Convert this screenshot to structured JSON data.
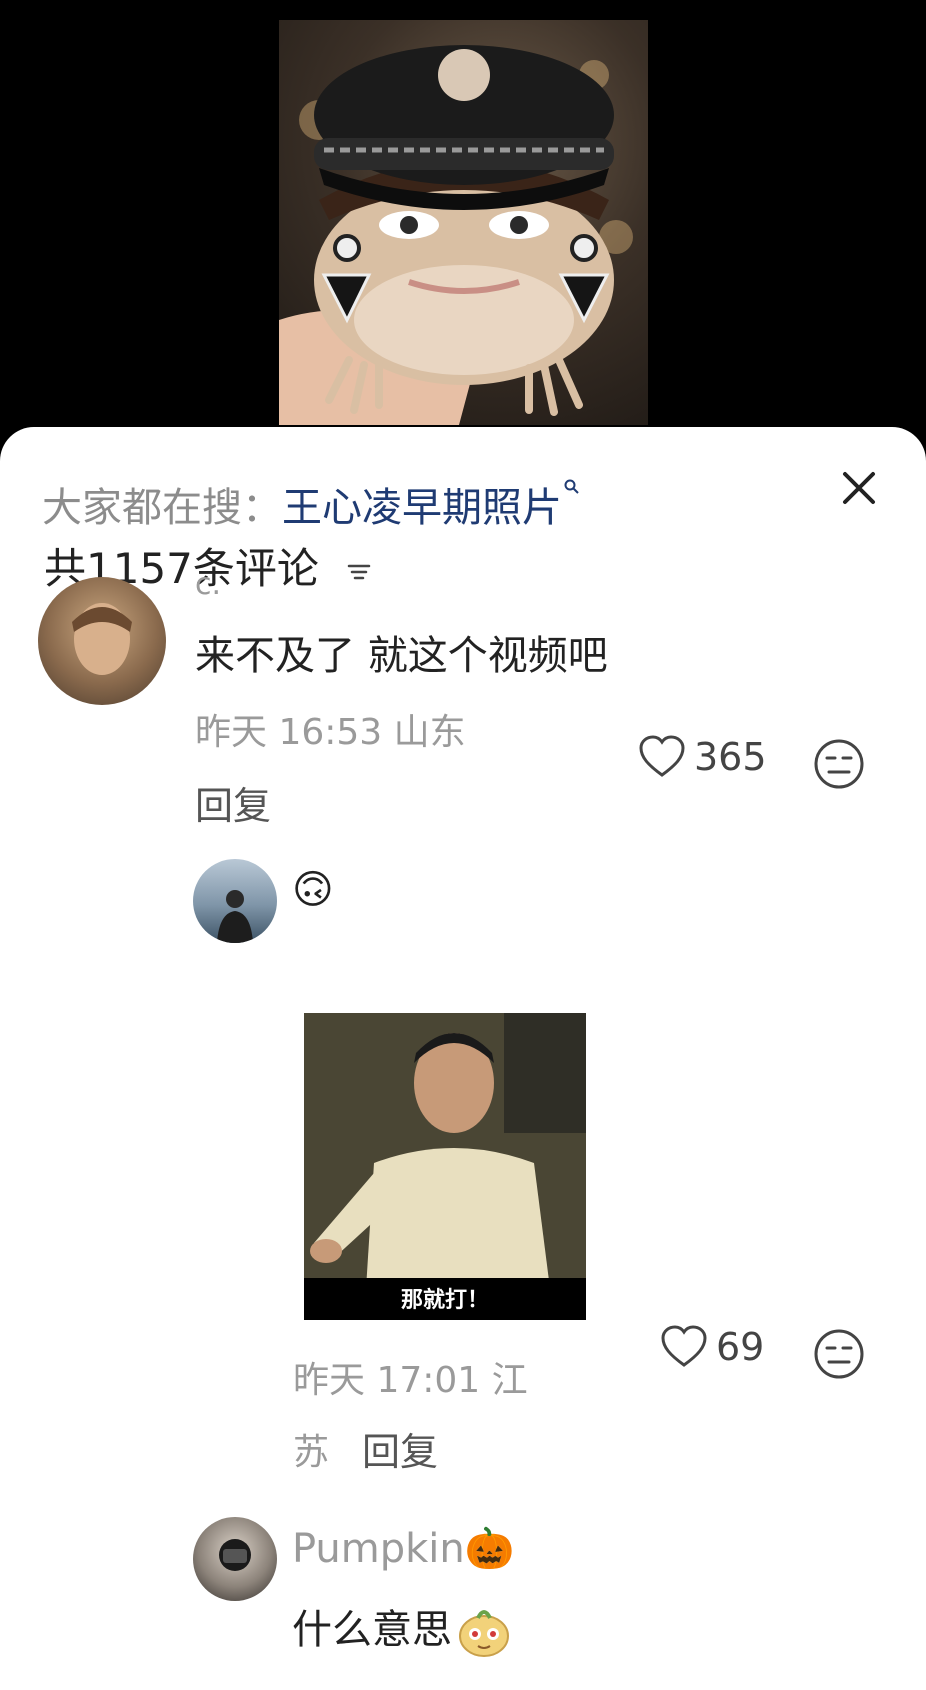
{
  "search": {
    "prefix": "大家都在搜：",
    "keyword": "王心凌早期照片",
    "close_label": "✕"
  },
  "comments_header": {
    "count_text": "共1157条评论"
  },
  "comments": [
    {
      "username_fragment": "c.",
      "text": "来不及了 就这个视频吧",
      "meta": "昨天 16:53 山东",
      "reply_label": "回复",
      "likes": "365"
    },
    {
      "username_emoji": "🙃",
      "meme_caption": "那就打！",
      "meta_line1": "昨天 17:01 江",
      "meta_line2": "苏",
      "reply_label": "回复",
      "likes": "69"
    },
    {
      "username": "Pumpkin🎃",
      "text": "什么意思"
    }
  ],
  "colors": {
    "keyword": "#1f3b73",
    "meta_gray": "#9a9a9a",
    "text": "#222222",
    "sheet_bg": "#ffffff",
    "top_bg": "#000000"
  },
  "icons": [
    "search-icon",
    "close-icon",
    "sort-icon",
    "heart-icon",
    "dislike-face-icon"
  ]
}
